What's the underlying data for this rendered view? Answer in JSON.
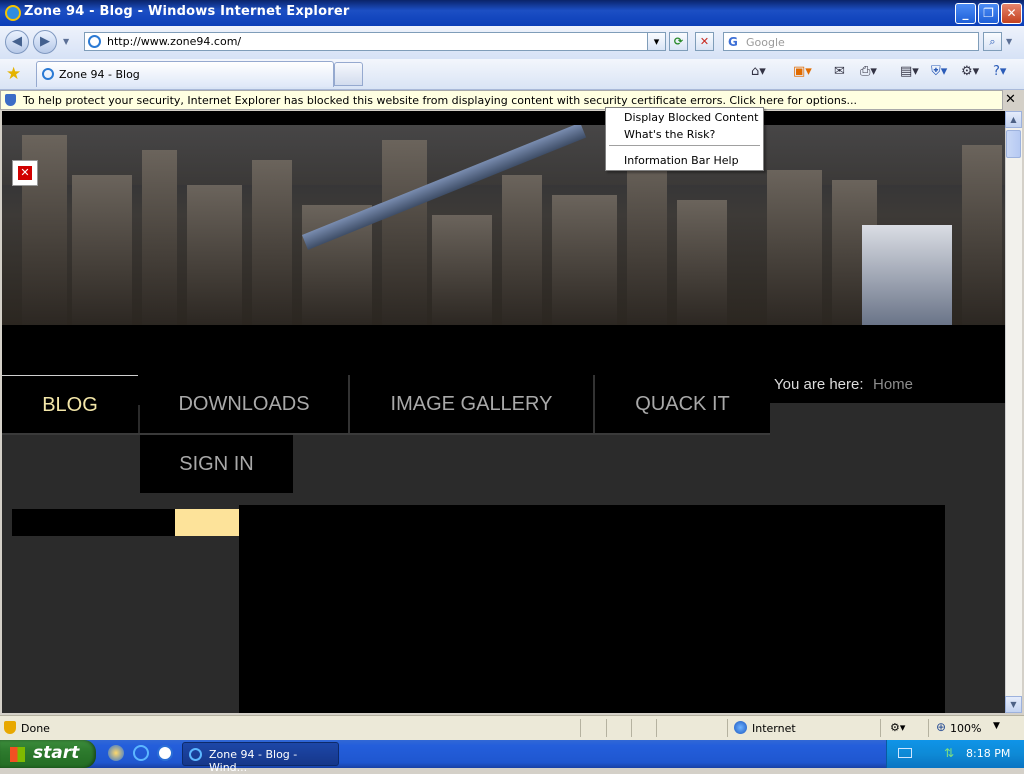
{
  "window": {
    "title": "Zone 94 - Blog - Windows Internet Explorer",
    "buttons": {
      "minimize": "_",
      "maximize": "❐",
      "close": "✕"
    }
  },
  "address_bar": {
    "url": "http://www.zone94.com/",
    "search_placeholder": "Google"
  },
  "tabs": [
    {
      "label": "Zone 94 - Blog"
    }
  ],
  "info_bar": {
    "message": "To help protect your security, Internet Explorer has blocked this website from displaying content with security certificate errors. Click here for options...",
    "close": "✕"
  },
  "context_menu": {
    "items": [
      "Display Blocked Content",
      "What's the Risk?",
      "Information Bar Help"
    ]
  },
  "site": {
    "nav": [
      "BLOG",
      "DOWNLOADS",
      "IMAGE GALLERY",
      "QUACK IT",
      "SIGN IN"
    ],
    "active_nav": "BLOG",
    "breadcrumb_label": "You are here:",
    "breadcrumb_home": "Home",
    "colors": {
      "active_nav": "#f3e6a8",
      "accent_block": "#fde39a",
      "page_bg": "#2b2b2b"
    }
  },
  "status_bar": {
    "status": "Done",
    "zone": "Internet",
    "zoom": "100%"
  },
  "taskbar": {
    "start_label": "start",
    "task_title": "Zone 94 - Blog - Wind...",
    "clock": "8:18 PM"
  }
}
